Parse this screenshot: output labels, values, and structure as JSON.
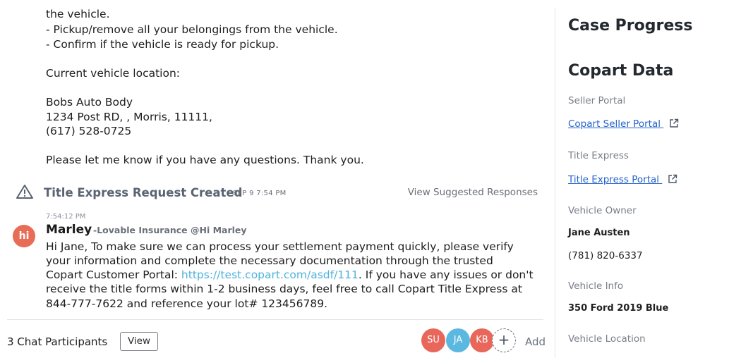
{
  "message_prev": {
    "lines": [
      "the vehicle.",
      "- Pickup/remove all your belongings from the vehicle.",
      "- Confirm if the vehicle is ready for pickup.",
      "Current vehicle location:",
      "Bobs Auto Body",
      "1234 Post RD, , Morris, 11111,",
      "(617) 528-0725",
      "Please let me know if you have any questions. Thank you."
    ]
  },
  "event": {
    "icon": "warning-icon",
    "title": "Title Express Request Created",
    "time": "SEP 9 7:54 PM",
    "suggested_responses": "View Suggested Responses"
  },
  "message": {
    "timestamp": "7:54:12 PM",
    "avatar_text": "hi",
    "sender": "Marley",
    "sender_org": "-Lovable Insurance @Hi Marley",
    "line1": "Hi Jane, To make sure we can process your settlement payment quickly, please verify",
    "line2": "your information and complete the necessary documentation through the trusted",
    "line3_pre": "Copart Customer Portal: ",
    "line3_link": "https://test.copart.com/asdf/111",
    "line3_post": ". If you have any issues or don't",
    "line4": "receive the title forms within 1-2 business days, feel free to call Copart Title Express at",
    "line5": "844-777-7622 and reference your lot# 123456789."
  },
  "footer": {
    "participants_label": "3 Chat Participants",
    "view_label": "View",
    "participants": [
      "SU",
      "JA",
      "KB"
    ],
    "participant_colors": [
      "#e8665a",
      "#5bb8e0",
      "#e8665a"
    ],
    "add_symbol": "+",
    "add_label": "Add"
  },
  "sidebar": {
    "case_progress": "Case Progress",
    "copart_data": "Copart Data",
    "seller_portal_label": "Seller Portal",
    "seller_portal_link": "Copart Seller Portal",
    "title_express_label": "Title Express",
    "title_express_link": "Title Express Portal",
    "vehicle_owner_label": "Vehicle Owner",
    "owner_name": "Jane Austen",
    "owner_phone": "(781) 820-6337",
    "vehicle_info_label": "Vehicle Info",
    "vehicle_info": "350 Ford 2019 Blue",
    "vehicle_location_label": "Vehicle Location"
  },
  "colors": {
    "accent_link": "#2563c9",
    "chat_link": "#4fb3dc",
    "avatar_hi": "#e86d57"
  }
}
